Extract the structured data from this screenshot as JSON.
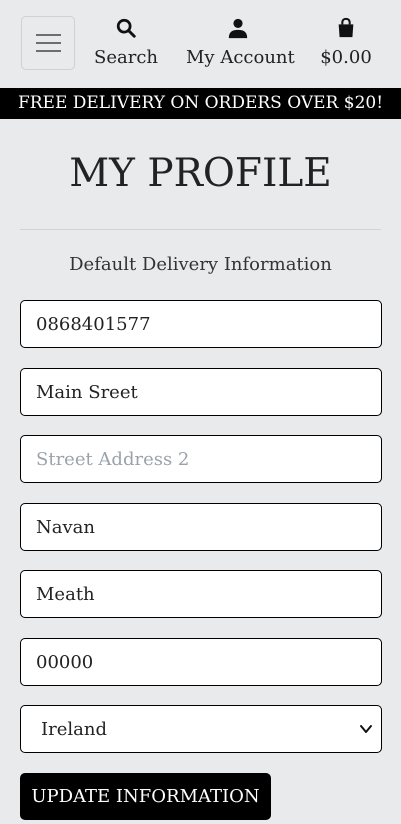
{
  "header": {
    "nav": {
      "search_label": "Search",
      "account_label": "My Account",
      "cart_total": "$0.00"
    },
    "icons": {
      "menu": "hamburger-menu-icon",
      "search": "search-icon",
      "account": "user-icon",
      "cart": "shopping-bag-icon"
    }
  },
  "banner": {
    "text": "FREE DELIVERY ON ORDERS OVER $20!"
  },
  "profile": {
    "title": "MY PROFILE",
    "subtitle": "Default Delivery Information",
    "form": {
      "phone": {
        "value": "0868401577",
        "placeholder": ""
      },
      "street_address_1": {
        "value": "Main Sreet",
        "placeholder": ""
      },
      "street_address_2": {
        "value": "",
        "placeholder": "Street Address 2"
      },
      "town_or_city": {
        "value": "Navan",
        "placeholder": ""
      },
      "county": {
        "value": "Meath",
        "placeholder": ""
      },
      "postcode": {
        "value": "00000",
        "placeholder": ""
      },
      "country": {
        "selected": "Ireland"
      },
      "submit_label": "UPDATE INFORMATION"
    }
  },
  "colors": {
    "background": "#e9eaec",
    "banner_bg": "#000000",
    "banner_text": "#ffffff",
    "button_bg": "#000000",
    "placeholder": "#9aa3ab"
  }
}
